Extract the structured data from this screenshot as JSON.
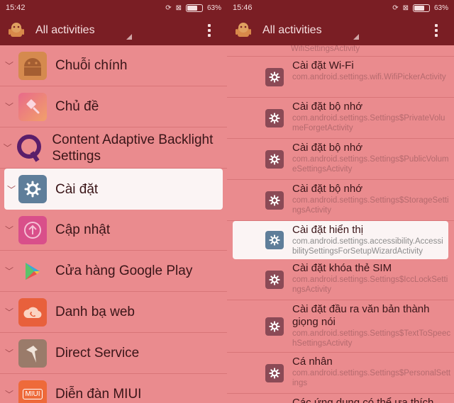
{
  "left": {
    "status": {
      "time": "15:42",
      "battery": "63%"
    },
    "appbar": {
      "title": "All activities"
    },
    "items": [
      {
        "label": "Chuỗi chính",
        "icon": "android-icon"
      },
      {
        "label": "Chủ đề",
        "icon": "theme-brush-icon"
      },
      {
        "label": "Content Adaptive Backlight Settings",
        "icon": "qualcomm-icon"
      },
      {
        "label": "Cài đặt",
        "icon": "gear-icon"
      },
      {
        "label": "Cập nhật",
        "icon": "update-arrow-icon"
      },
      {
        "label": "Cửa hàng Google Play",
        "icon": "play-store-icon"
      },
      {
        "label": "Danh bạ web",
        "icon": "cloud-contacts-icon"
      },
      {
        "label": "Direct Service",
        "icon": "hummingbird-icon"
      },
      {
        "label": "Diễn đàn MIUI",
        "icon": "miui-forum-icon"
      }
    ]
  },
  "right": {
    "status": {
      "time": "15:46",
      "battery": "63%"
    },
    "appbar": {
      "title": "All activities"
    },
    "top_partial": "WifiSettingsActivity",
    "items": [
      {
        "title": "Cài đặt Wi-Fi",
        "sub": "com.android.settings.wifi.WifiPickerActivity"
      },
      {
        "title": "Cài đặt bộ nhớ",
        "sub": "com.android.settings.Settings$PrivateVolumeForgetActivity"
      },
      {
        "title": "Cài đặt bộ nhớ",
        "sub": "com.android.settings.Settings$PublicVolumeSettingsActivity"
      },
      {
        "title": "Cài đặt bộ nhớ",
        "sub": "com.android.settings.Settings$StorageSettingsActivity"
      },
      {
        "title": "Cài đặt hiển thị",
        "sub": "com.android.settings.accessibility.AccessibilitySettingsForSetupWizardActivity"
      },
      {
        "title": "Cài đặt khóa thẻ SIM",
        "sub": "com.android.settings.Settings$IccLockSettingsActivity"
      },
      {
        "title": "Cài đặt đầu ra văn bản thành giọng nói",
        "sub": "com.android.settings.Settings$TextToSpeechSettingsActivity"
      },
      {
        "title": "Cá nhân",
        "sub": "com.android.settings.Settings$PersonalSettings"
      },
      {
        "title": "Các ứng dụng có thể ưa thích",
        "sub": ""
      }
    ]
  }
}
